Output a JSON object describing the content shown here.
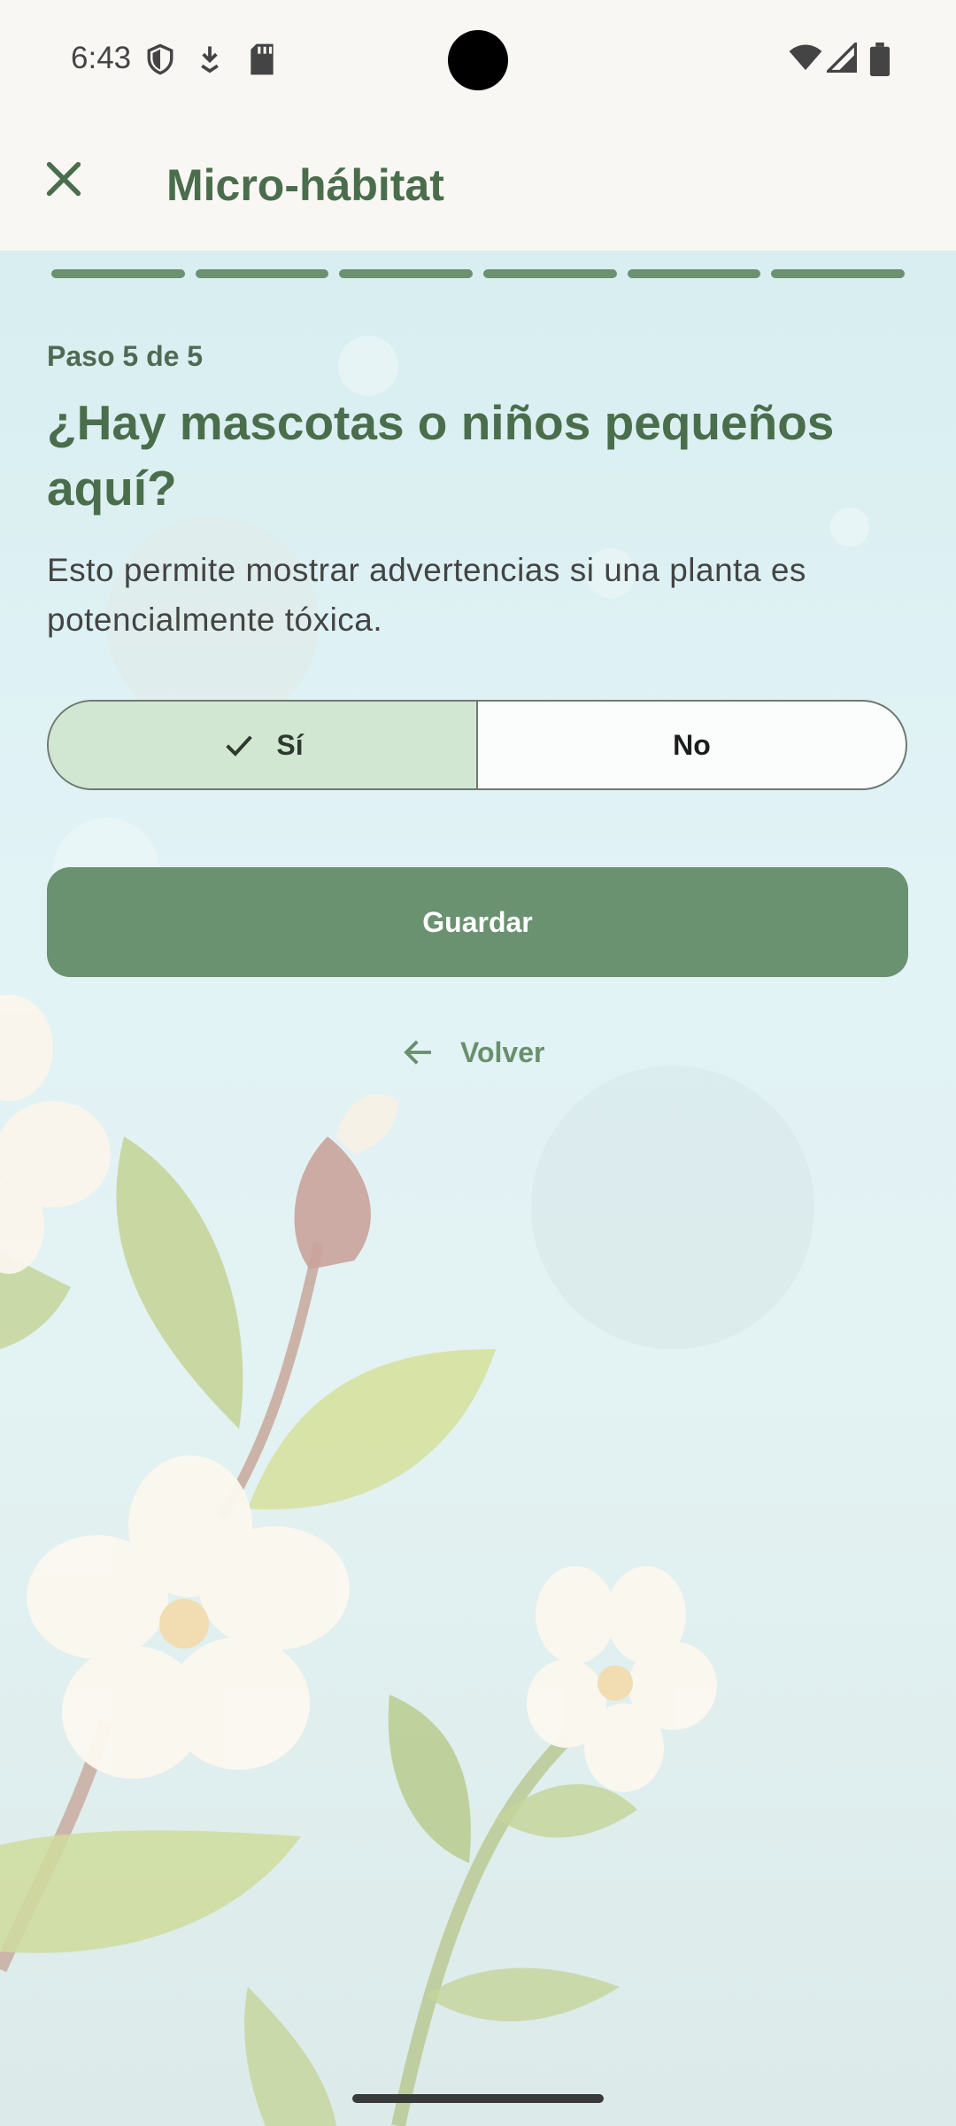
{
  "status_bar": {
    "time": "6:43",
    "icons": [
      "shield-icon",
      "download-icon",
      "sd-card-icon",
      "wifi-icon",
      "signal-icon",
      "battery-icon"
    ]
  },
  "app_bar": {
    "close_icon": "close-icon",
    "title": "Micro-hábitat"
  },
  "progress": {
    "segments_total": 6,
    "segments_filled": 6,
    "color": "#6a9170"
  },
  "step": {
    "label": "Paso 5 de 5",
    "question": "¿Hay mascotas o niños pequeños aquí?",
    "helper": "Esto permite mostrar advertencias si una planta es potencialmente tóxica."
  },
  "options": {
    "yes_label": "Sí",
    "no_label": "No",
    "selected": "Sí",
    "check_icon": "check-icon"
  },
  "actions": {
    "save_label": "Guardar",
    "back_label": "Volver",
    "back_icon": "arrow-left-icon"
  },
  "colors": {
    "primary": "#6a9170",
    "title": "#4a6e4c",
    "selected_bg": "#d2e7d2",
    "background": "#e2f3f6"
  }
}
